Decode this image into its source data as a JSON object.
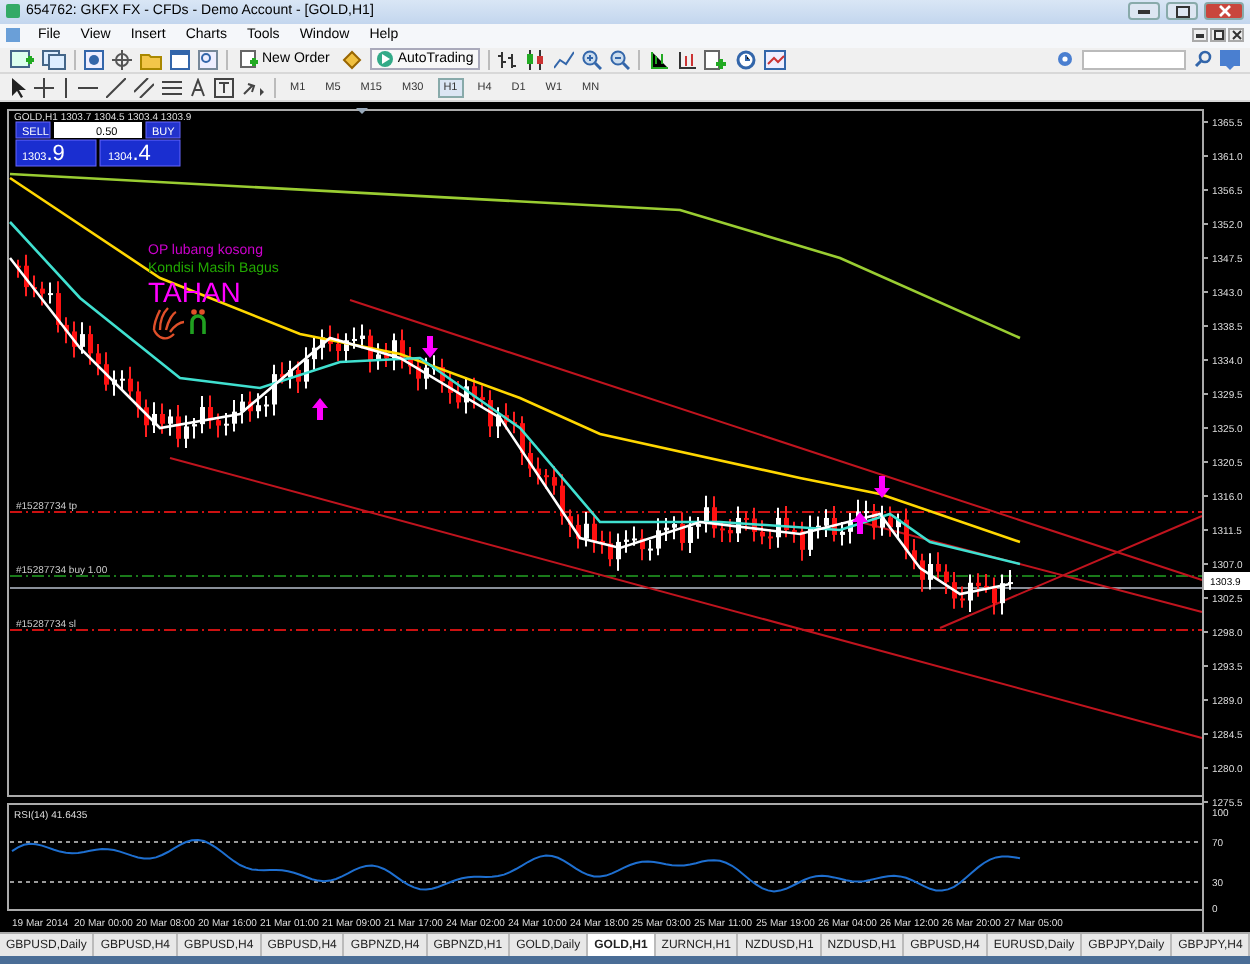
{
  "window": {
    "title": "654762: GKFX FX - CFDs - Demo Account - [GOLD,H1]"
  },
  "menu": [
    "File",
    "View",
    "Insert",
    "Charts",
    "Tools",
    "Window",
    "Help"
  ],
  "toolbar": {
    "new_order": "New Order",
    "auto_trading": "AutoTrading",
    "timeframes": [
      {
        "label": "M1",
        "selected": false
      },
      {
        "label": "M5",
        "selected": false
      },
      {
        "label": "M15",
        "selected": false
      },
      {
        "label": "M30",
        "selected": false
      },
      {
        "label": "H1",
        "selected": true
      },
      {
        "label": "H4",
        "selected": false
      },
      {
        "label": "D1",
        "selected": false
      },
      {
        "label": "W1",
        "selected": false
      },
      {
        "label": "MN",
        "selected": false
      }
    ]
  },
  "chart": {
    "header": "GOLD,H1  1303.7 1304.5 1303.4 1303.9",
    "one_click": {
      "sell": "SELL",
      "lots": "0.50",
      "buy": "BUY",
      "bid_big": "1303",
      "bid_small": ".9",
      "ask_big": "1304",
      "ask_small": ".4"
    },
    "notes": [
      {
        "text": "OP lubang kosong",
        "kind": "small",
        "color": "#cc00cc"
      },
      {
        "text": "Kondisi Masih Bagus",
        "kind": "small",
        "color": "#22aa00"
      },
      {
        "text": "TAHAN",
        "kind": "big",
        "color": "#ff00ff"
      }
    ],
    "order_lines": [
      {
        "label": "#15287734 tp",
        "kind": "tp"
      },
      {
        "label": "#15287734 buy 1.00",
        "kind": "buy"
      },
      {
        "label": "#15287734 sl",
        "kind": "sl"
      }
    ],
    "price_axis": [
      "1365.5",
      "1361.0",
      "1356.5",
      "1352.0",
      "1347.5",
      "1343.0",
      "1338.5",
      "1334.0",
      "1329.5",
      "1325.0",
      "1320.5",
      "1316.0",
      "1311.5",
      "1307.0",
      "1302.5",
      "1298.0",
      "1293.5",
      "1289.0",
      "1284.5",
      "1280.0",
      "1275.5"
    ],
    "current_price": "1303.9"
  },
  "indicator": {
    "label": "RSI(14) 41.6435",
    "levels": [
      "100",
      "70",
      "30",
      "0"
    ]
  },
  "time_axis": [
    "19 Mar 2014",
    "20 Mar 00:00",
    "20 Mar 08:00",
    "20 Mar 16:00",
    "21 Mar 01:00",
    "21 Mar 09:00",
    "21 Mar 17:00",
    "24 Mar 02:00",
    "24 Mar 10:00",
    "24 Mar 18:00",
    "25 Mar 03:00",
    "25 Mar 11:00",
    "25 Mar 19:00",
    "26 Mar 04:00",
    "26 Mar 12:00",
    "26 Mar 20:00",
    "27 Mar 05:00"
  ],
  "tabs": [
    {
      "label": "GBPUSD,Daily",
      "selected": false
    },
    {
      "label": "GBPUSD,H4",
      "selected": false
    },
    {
      "label": "GBPUSD,H4",
      "selected": false
    },
    {
      "label": "GBPUSD,H4",
      "selected": false
    },
    {
      "label": "GBPNZD,H4",
      "selected": false
    },
    {
      "label": "GBPNZD,H1",
      "selected": false
    },
    {
      "label": "GOLD,Daily",
      "selected": false
    },
    {
      "label": "GOLD,H1",
      "selected": true
    },
    {
      "label": "ZURNCH,H1",
      "selected": false
    },
    {
      "label": "NZDUSD,H1",
      "selected": false
    },
    {
      "label": "NZDUSD,H1",
      "selected": false
    },
    {
      "label": "GBPUSD,H4",
      "selected": false
    },
    {
      "label": "EURUSD,Daily",
      "selected": false
    },
    {
      "label": "GBPJPY,Daily",
      "selected": false
    },
    {
      "label": "GBPJPY,H4",
      "selected": false
    }
  ]
}
